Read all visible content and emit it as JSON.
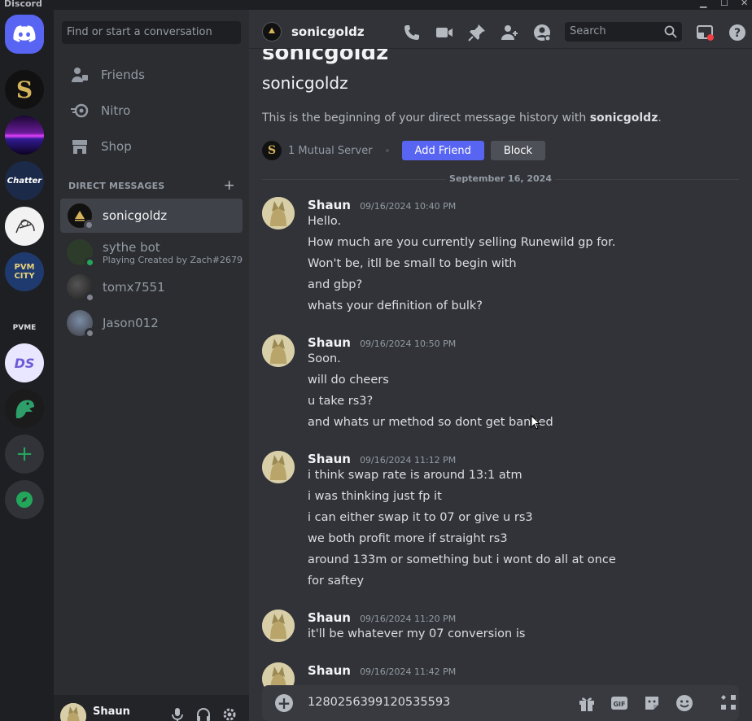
{
  "window": {
    "brand": "Discord",
    "minimize": "▁",
    "maximize": "☐",
    "close": "✕"
  },
  "servers": [
    {
      "name": "home"
    },
    {
      "name": "gold-s-server",
      "letter": "S"
    },
    {
      "name": "neon-server"
    },
    {
      "name": "chatter-server",
      "letter": "Chatter"
    },
    {
      "name": "sketch-server"
    },
    {
      "name": "pvm-city-server",
      "letter": "PVM CITY"
    },
    {
      "name": "pvme-server",
      "letter": "PVME"
    },
    {
      "name": "ds-server",
      "letter": "DS"
    },
    {
      "name": "dino-server"
    }
  ],
  "sidebar": {
    "search_placeholder": "Find or start a conversation",
    "nav": [
      {
        "label": "Friends"
      },
      {
        "label": "Nitro"
      },
      {
        "label": "Shop"
      }
    ],
    "dm_header": "Direct Messages",
    "dm_add": "+",
    "dms": [
      {
        "name": "sonicgoldz",
        "status": "offline",
        "active": true
      },
      {
        "name": "sythe bot",
        "sub": "Playing Created by Zach#2679",
        "status": "online"
      },
      {
        "name": "tomx7551",
        "status": "offline"
      },
      {
        "name": "Jason012",
        "status": "offline"
      }
    ]
  },
  "user_panel": {
    "name": "Shaun"
  },
  "header": {
    "name": "sonicgoldz",
    "search_placeholder": "Search"
  },
  "intro": {
    "big_name": "sonicgoldz",
    "name": "sonicgoldz",
    "desc_prefix": "This is the beginning of your direct message history with ",
    "desc_name": "sonicgoldz",
    "desc_suffix": ".",
    "mutual_letter": "S",
    "mutual": "1 Mutual Server",
    "add_friend": "Add Friend",
    "block": "Block"
  },
  "date_divider": "September 16, 2024",
  "messages": [
    {
      "author": "Shaun",
      "timestamp": "09/16/2024 10:40 PM",
      "lines": [
        "Hello.",
        "How much are you currently selling Runewild gp for.",
        "Won't be, itll be small to begin with",
        "and gbp?",
        "whats your definition of bulk?"
      ]
    },
    {
      "author": "Shaun",
      "timestamp": "09/16/2024 10:50 PM",
      "lines": [
        "Soon.",
        "will do cheers",
        "u take rs3?",
        "and whats ur method so dont get banned"
      ]
    },
    {
      "author": "Shaun",
      "timestamp": "09/16/2024 11:12 PM",
      "lines": [
        "i think swap rate is around 13:1 atm",
        "i was thinking just fp it",
        "i can either swap it to 07 or give u rs3",
        "we both profit more if straight rs3",
        "around 133m or something but i wont do all at once",
        "for saftey"
      ]
    },
    {
      "author": "Shaun",
      "timestamp": "09/16/2024 11:20 PM",
      "lines": [
        "it'll be whatever my 07 conversion is"
      ]
    },
    {
      "author": "Shaun",
      "timestamp": "09/16/2024 11:42 PM",
      "lines": []
    }
  ],
  "composer": {
    "text": "1280256399120535593",
    "gif": "GIF"
  },
  "colors": {
    "accent": "#5865f2",
    "online": "#23a55a",
    "offline": "#80848e"
  }
}
